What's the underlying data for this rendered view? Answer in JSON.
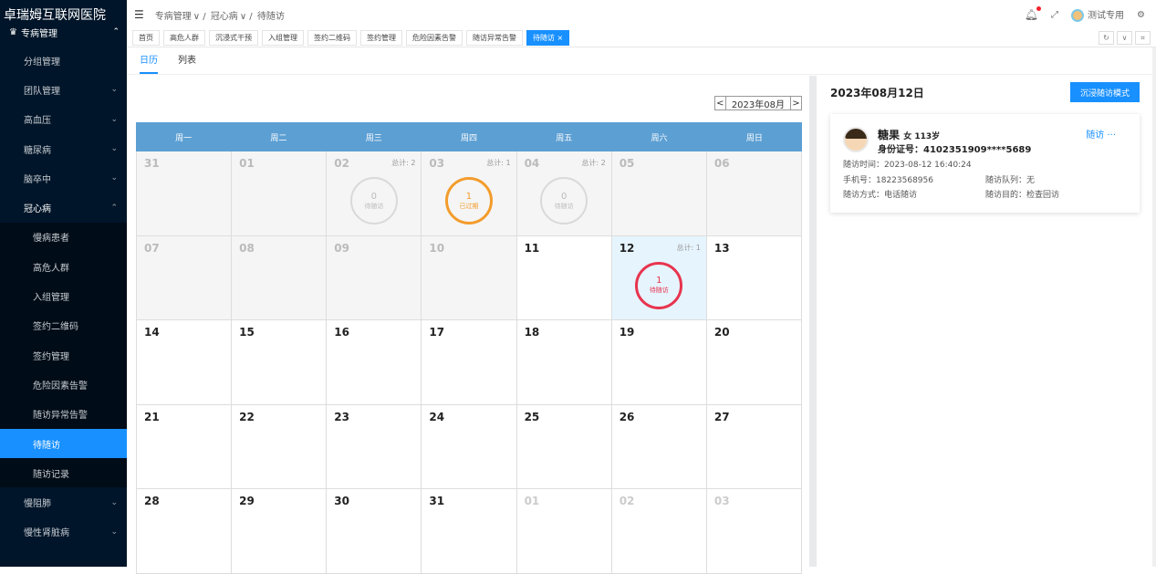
{
  "app": {
    "title": "卓瑞姆互联网医院"
  },
  "sidebar": {
    "top": {
      "label": "专病管理"
    },
    "items": [
      {
        "label": "分组管理",
        "sub": false,
        "arrow": false
      },
      {
        "label": "团队管理",
        "sub": false,
        "arrow": true
      },
      {
        "label": "高血压",
        "sub": false,
        "arrow": true
      },
      {
        "label": "糖尿病",
        "sub": false,
        "arrow": true
      },
      {
        "label": "脑卒中",
        "sub": false,
        "arrow": true
      },
      {
        "label": "冠心病",
        "sub": false,
        "arrow": true,
        "open": true
      },
      {
        "label": "慢病患者",
        "sub": true
      },
      {
        "label": "高危人群",
        "sub": true
      },
      {
        "label": "入组管理",
        "sub": true
      },
      {
        "label": "签约二维码",
        "sub": true
      },
      {
        "label": "签约管理",
        "sub": true
      },
      {
        "label": "危险因素告警",
        "sub": true
      },
      {
        "label": "随访异常告警",
        "sub": true
      },
      {
        "label": "待随访",
        "sub": true,
        "active": true
      },
      {
        "label": "随访记录",
        "sub": true
      },
      {
        "label": "慢阻肺",
        "sub": false,
        "arrow": true
      },
      {
        "label": "慢性肾脏病",
        "sub": false,
        "arrow": true
      }
    ]
  },
  "header": {
    "breadcrumb": [
      "专病管理",
      "冠心病",
      "待随访"
    ],
    "user": "测试专用"
  },
  "tabs": [
    {
      "label": "首页"
    },
    {
      "label": "高危人群"
    },
    {
      "label": "沉浸式干预"
    },
    {
      "label": "入组管理"
    },
    {
      "label": "签约二维码"
    },
    {
      "label": "签约管理"
    },
    {
      "label": "危险因素告警"
    },
    {
      "label": "随访异常告警"
    },
    {
      "label": "待随访 ×",
      "active": true
    }
  ],
  "subtabs": [
    {
      "label": "日历",
      "active": true
    },
    {
      "label": "列表"
    }
  ],
  "calendar": {
    "month": "2023年08月",
    "weekdays": [
      "周一",
      "周二",
      "周三",
      "周四",
      "周五",
      "周六",
      "周日"
    ],
    "cells": [
      {
        "d": "31",
        "type": "past"
      },
      {
        "d": "01",
        "type": "past"
      },
      {
        "d": "02",
        "type": "past",
        "total": "总计: 2",
        "count": "0",
        "status": "待随访",
        "style": "gray"
      },
      {
        "d": "03",
        "type": "past",
        "total": "总计: 1",
        "count": "1",
        "status": "已过期",
        "style": "orange"
      },
      {
        "d": "04",
        "type": "past",
        "total": "总计: 2",
        "count": "0",
        "status": "待随访",
        "style": "gray"
      },
      {
        "d": "05",
        "type": "past"
      },
      {
        "d": "06",
        "type": "past"
      },
      {
        "d": "07",
        "type": "past"
      },
      {
        "d": "08",
        "type": "past"
      },
      {
        "d": "09",
        "type": "past"
      },
      {
        "d": "10",
        "type": "past"
      },
      {
        "d": "11",
        "type": "cur"
      },
      {
        "d": "12",
        "type": "today",
        "total": "总计: 1",
        "count": "1",
        "status": "待随访",
        "style": "red"
      },
      {
        "d": "13",
        "type": "cur"
      },
      {
        "d": "14",
        "type": "cur"
      },
      {
        "d": "15",
        "type": "cur"
      },
      {
        "d": "16",
        "type": "cur"
      },
      {
        "d": "17",
        "type": "cur"
      },
      {
        "d": "18",
        "type": "cur"
      },
      {
        "d": "19",
        "type": "cur"
      },
      {
        "d": "20",
        "type": "cur"
      },
      {
        "d": "21",
        "type": "cur"
      },
      {
        "d": "22",
        "type": "cur"
      },
      {
        "d": "23",
        "type": "cur"
      },
      {
        "d": "24",
        "type": "cur"
      },
      {
        "d": "25",
        "type": "cur"
      },
      {
        "d": "26",
        "type": "cur"
      },
      {
        "d": "27",
        "type": "cur"
      },
      {
        "d": "28",
        "type": "cur"
      },
      {
        "d": "29",
        "type": "cur"
      },
      {
        "d": "30",
        "type": "cur"
      },
      {
        "d": "31",
        "type": "cur"
      },
      {
        "d": "01",
        "type": "other"
      },
      {
        "d": "02",
        "type": "other"
      },
      {
        "d": "03",
        "type": "other"
      }
    ]
  },
  "detail": {
    "date": "2023年08月12日",
    "immerse_btn": "沉浸随访模式",
    "patient": {
      "name": "糖果",
      "sex_age": "女 113岁",
      "id": "身份证号：4102351909****5689",
      "visit_link": "随访 ···",
      "visit_time": "随访时间：2023-08-12 16:40:24",
      "phone": "手机号：18223568956",
      "queue": "随访队列：无",
      "method": "随访方式：电话随访",
      "purpose": "随访目的：检查回访"
    }
  }
}
